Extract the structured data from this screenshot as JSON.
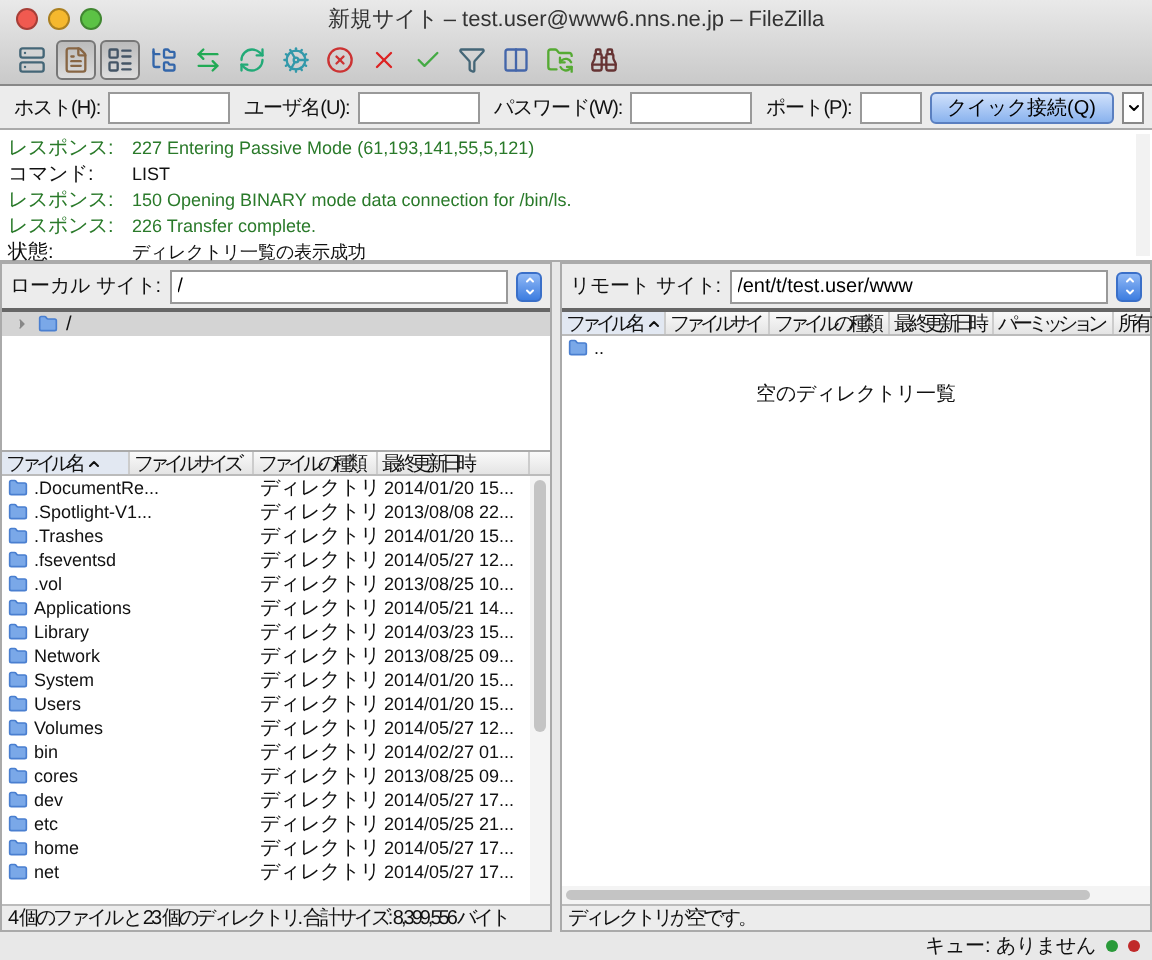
{
  "window": {
    "title": "新規サイト – test.user@www6.nns.ne.jp – FileZilla"
  },
  "toolbar": [
    {
      "kind": "server",
      "pressed": false
    },
    {
      "kind": "log",
      "pressed": true
    },
    {
      "kind": "list",
      "pressed": true
    },
    {
      "kind": "tree",
      "pressed": false
    },
    {
      "kind": "sync",
      "pressed": false
    },
    {
      "kind": "refresh",
      "pressed": false
    },
    {
      "kind": "process",
      "pressed": false
    },
    {
      "kind": "stop",
      "pressed": false
    },
    {
      "kind": "cancel",
      "pressed": false
    },
    {
      "kind": "reconnect",
      "pressed": false
    },
    {
      "kind": "filter",
      "pressed": false
    },
    {
      "kind": "compare",
      "pressed": false
    },
    {
      "kind": "sync-browse",
      "pressed": false
    },
    {
      "kind": "search",
      "pressed": false
    }
  ],
  "quickconnect": {
    "fields": [
      {
        "label": "ホスト(H):"
      },
      {
        "label": "ユーザ名(U):"
      },
      {
        "label": "パスワード(W):"
      },
      {
        "label": "ポート(P):"
      }
    ],
    "button": "クイック接続(Q)"
  },
  "log": [
    {
      "kind": "response",
      "label": "レスポンス:",
      "text": "227 Entering Passive Mode (61,193,141,55,5,121)"
    },
    {
      "kind": "command",
      "label": "コマンド:",
      "text": "LIST"
    },
    {
      "kind": "response",
      "label": "レスポンス:",
      "text": "150 Opening BINARY mode data connection for /bin/ls."
    },
    {
      "kind": "response",
      "label": "レスポンス:",
      "text": "226 Transfer complete."
    },
    {
      "kind": "status",
      "label": "状態:",
      "text": "ディレクトリ一覧の表示成功"
    }
  ],
  "local": {
    "label": "ローカル サイト:",
    "path": "/",
    "tree": [
      {
        "label": "/",
        "selected": true,
        "expanded": false
      }
    ],
    "columns": [
      {
        "label": "ファイル名",
        "sorted": true
      },
      {
        "label": "ファイルサイズ",
        "sorted": false
      },
      {
        "label": "ファイルの種類",
        "sorted": false
      },
      {
        "label": "最終更新日時",
        "sorted": false
      }
    ],
    "rows": [
      {
        "name": ".DocumentRe...",
        "type": "ディレクトリ",
        "modified": "2014/01/20 15..."
      },
      {
        "name": ".Spotlight-V1...",
        "type": "ディレクトリ",
        "modified": "2013/08/08 22..."
      },
      {
        "name": ".Trashes",
        "type": "ディレクトリ",
        "modified": "2014/01/20 15..."
      },
      {
        "name": ".fseventsd",
        "type": "ディレクトリ",
        "modified": "2014/05/27 12..."
      },
      {
        "name": ".vol",
        "type": "ディレクトリ",
        "modified": "2013/08/25 10..."
      },
      {
        "name": "Applications",
        "type": "ディレクトリ",
        "modified": "2014/05/21 14..."
      },
      {
        "name": "Library",
        "type": "ディレクトリ",
        "modified": "2014/03/23 15..."
      },
      {
        "name": "Network",
        "type": "ディレクトリ",
        "modified": "2013/08/25 09..."
      },
      {
        "name": "System",
        "type": "ディレクトリ",
        "modified": "2014/01/20 15..."
      },
      {
        "name": "Users",
        "type": "ディレクトリ",
        "modified": "2014/01/20 15..."
      },
      {
        "name": "Volumes",
        "type": "ディレクトリ",
        "modified": "2014/05/27 12..."
      },
      {
        "name": "bin",
        "type": "ディレクトリ",
        "modified": "2014/02/27 01..."
      },
      {
        "name": "cores",
        "type": "ディレクトリ",
        "modified": "2013/08/25 09..."
      },
      {
        "name": "dev",
        "type": "ディレクトリ",
        "modified": "2014/05/27 17..."
      },
      {
        "name": "etc",
        "type": "ディレクトリ",
        "modified": "2014/05/25 21..."
      },
      {
        "name": "home",
        "type": "ディレクトリ",
        "modified": "2014/05/27 17..."
      },
      {
        "name": "net",
        "type": "ディレクトリ",
        "modified": "2014/05/27 17..."
      }
    ],
    "status": "4 個のファイル と 23 個のディレクトリ. 合計サイズ: 8,399,556 バイト"
  },
  "remote": {
    "label": "リモート サイト:",
    "path": "/ent/t/test.user/www",
    "columns": [
      {
        "label": "ファイル名",
        "sorted": true
      },
      {
        "label": "ファイルサイ",
        "sorted": false
      },
      {
        "label": "ファイルの種類",
        "sorted": false
      },
      {
        "label": "最終更新日時",
        "sorted": false
      },
      {
        "label": "パーミッション",
        "sorted": false
      },
      {
        "label": "所有",
        "sorted": false
      }
    ],
    "rows": [
      {
        "name": ".."
      }
    ],
    "empty_message": "空のディレクトリ一覧",
    "status": "ディレクトリが空です。"
  },
  "status_bar": {
    "queue": "キュー: ありません"
  }
}
